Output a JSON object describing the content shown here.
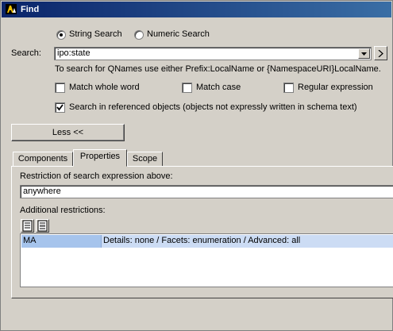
{
  "window": {
    "title": "Find"
  },
  "search_mode": {
    "string_label": "String Search",
    "numeric_label": "Numeric Search",
    "selected": "string"
  },
  "search": {
    "label": "Search:",
    "value": "ipo:state",
    "hint": "To search for QNames use either Prefix:LocalName or {NamespaceURI}LocalName."
  },
  "options": {
    "match_whole_word": {
      "label": "Match whole word",
      "checked": false
    },
    "match_case": {
      "label": "Match case",
      "checked": false
    },
    "regular_expression": {
      "label": "Regular expression",
      "checked": false
    },
    "search_referenced": {
      "label": "Search in referenced objects (objects not expressly written in schema text)",
      "checked": true
    }
  },
  "less_button": {
    "label": "Less <<"
  },
  "tabs": [
    {
      "label": "Components",
      "active": false
    },
    {
      "label": "Properties",
      "active": true
    },
    {
      "label": "Scope",
      "active": false
    }
  ],
  "properties": {
    "restriction_label": "Restriction of search expression above:",
    "restriction_value": "anywhere",
    "additional_label": "Additional restrictions:",
    "toolbar_icons": [
      "insert-row-icon",
      "append-row-icon"
    ],
    "rows": [
      {
        "name": "MA",
        "details": "Details: none / Facets: enumeration / Advanced: all"
      }
    ]
  },
  "colors": {
    "titlebar": "#0a246a",
    "face": "#d4d0c8",
    "row_selected": "#a6c4ec"
  }
}
